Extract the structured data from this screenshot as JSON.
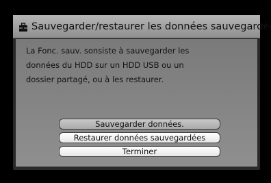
{
  "dialog": {
    "title": "Sauvegarder/restaurer les données sauvegardées",
    "title_icon": "toolbox-icon",
    "description_lines": [
      "La Fonc. sauv. sonsiste à sauvegarder les",
      "données du HDD sur un HDD USB ou un",
      "dossier partagé, ou à les restaurer."
    ]
  },
  "menu": {
    "items": [
      {
        "label": "Sauvegarder données.",
        "selected": true
      },
      {
        "label": "Restaurer données sauvegardées",
        "selected": false
      },
      {
        "label": "Terminer",
        "selected": false
      }
    ]
  },
  "colors": {
    "title_bar": "#a6a6a6",
    "panel": "#868686",
    "frame": "#2a2a2a",
    "background": "#000000"
  }
}
